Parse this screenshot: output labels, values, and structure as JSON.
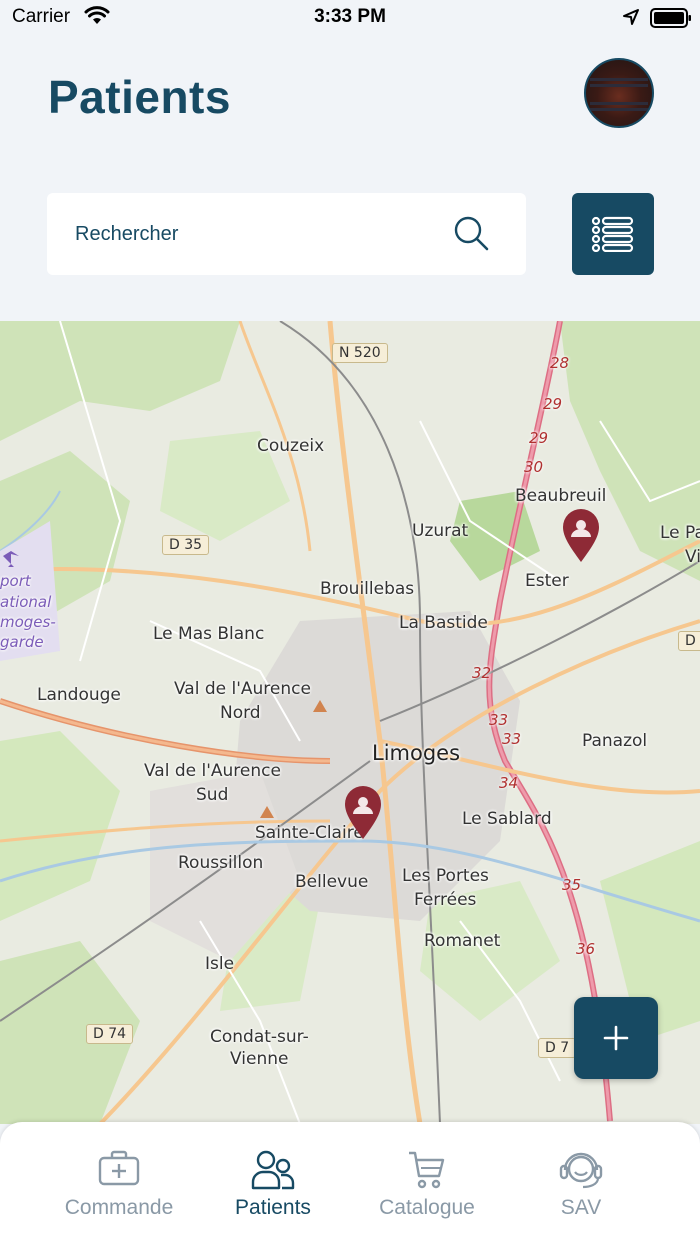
{
  "status_bar": {
    "carrier": "Carrier",
    "time": "3:33 PM"
  },
  "header": {
    "title": "Patients"
  },
  "search": {
    "placeholder": "Rechercher"
  },
  "map": {
    "places": {
      "couzeix": "Couzeix",
      "beaubreuil": "Beaubreuil",
      "uzurat": "Uzurat",
      "le_pa": "Le Pa",
      "vi": "Vi",
      "d35": "D 35",
      "n520": "N 520",
      "airport1": "port",
      "airport2": "ational",
      "airport3": "moges-",
      "airport4": "garde",
      "brouillebas": "Brouillebas",
      "ester": "Ester",
      "le_mas_blanc": "Le Mas Blanc",
      "la_bastide": "La Bastide",
      "landouge": "Landouge",
      "val_nord_1": "Val de l'Aurence",
      "val_nord_2": "Nord",
      "limoges": "Limoges",
      "panazol": "Panazol",
      "val_sud_1": "Val de l'Aurence",
      "val_sud_2": "Sud",
      "sainte_claire": "Sainte-Claire",
      "le_sablard": "Le Sablard",
      "roussillon": "Roussillon",
      "bellevue": "Bellevue",
      "les_portes_1": "Les Portes",
      "les_portes_2": "Ferrées",
      "romanet": "Romanet",
      "isle": "Isle",
      "d74": "D 74",
      "condat_1": "Condat-sur-",
      "condat_2": "Vienne",
      "d7": "D 7",
      "d_right": "D"
    },
    "km_markers": {
      "k28": "28",
      "k29": "29",
      "k29b": "29",
      "k30": "30",
      "k32": "32",
      "k33": "33",
      "k33b": "33",
      "k34": "34",
      "k35": "35",
      "k36": "36"
    },
    "pins": [
      {
        "name": "patient-pin-ester"
      },
      {
        "name": "patient-pin-sainte-claire"
      }
    ]
  },
  "tabs": [
    {
      "label": "Commande",
      "icon": "medical-case-icon",
      "active": false
    },
    {
      "label": "Patients",
      "icon": "users-icon",
      "active": true
    },
    {
      "label": "Catalogue",
      "icon": "cart-icon",
      "active": false
    },
    {
      "label": "SAV",
      "icon": "support-headset-icon",
      "active": false
    }
  ],
  "colors": {
    "primary": "#174a63",
    "pin": "#8e2a36",
    "inactive": "#8a99a6",
    "background": "#f1f4f8"
  }
}
